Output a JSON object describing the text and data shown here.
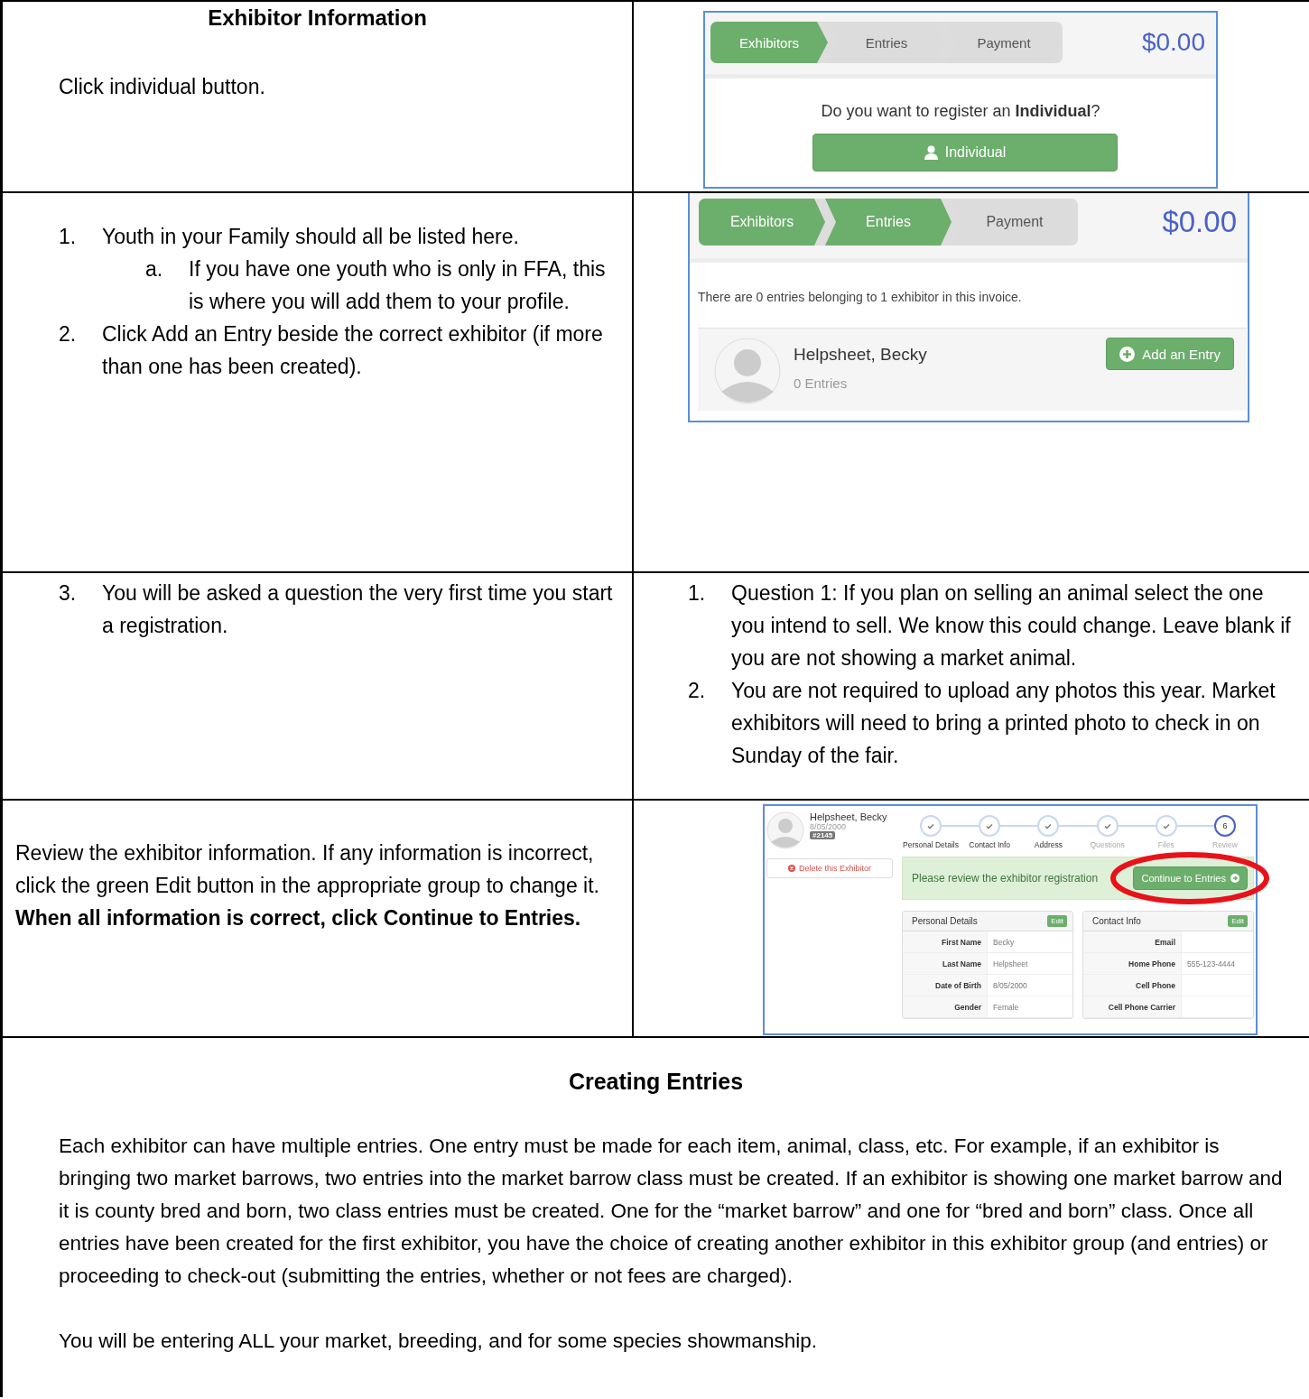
{
  "rows": [
    {
      "left": {
        "kind": "text",
        "title": "Exhibitor Information",
        "paragraphs": [
          "Click individual button."
        ]
      },
      "right": {
        "kind": "register",
        "wizard": {
          "steps": [
            {
              "label": "Exhibitors",
              "done": true
            },
            {
              "label": "Entries",
              "done": false
            },
            {
              "label": "Payment",
              "done": false
            }
          ],
          "total": "$0.00"
        },
        "question": "Do you want to register an **Individual**?",
        "button": "Individual"
      }
    },
    {
      "left": {
        "kind": "list",
        "items": [
          {
            "number": "1.",
            "text": "Youth in your Family should all be listed here.",
            "children": [
              {
                "number": "a.",
                "text": "If you have one youth who is only in FFA, this is where you will add them to your profile."
              }
            ]
          },
          {
            "number": "2.",
            "text": "Click Add an Entry beside the correct exhibitor (if more than one has been created)."
          }
        ]
      },
      "right": {
        "kind": "entries",
        "wizard": {
          "steps": [
            {
              "label": "Exhibitors",
              "done": true
            },
            {
              "label": "Entries",
              "done": true
            },
            {
              "label": "Payment",
              "done": false
            }
          ],
          "total": "$0.00"
        },
        "summary": "There are 0 entries belonging to 1 exhibitor in this invoice.",
        "exhibitor": {
          "name": "Helpsheet, Becky",
          "count": "0 Entries"
        },
        "button": "Add an Entry"
      }
    },
    {
      "left": {
        "kind": "list",
        "items": [
          {
            "number": "3.",
            "text": "You will be asked a question the very first time you start a registration."
          }
        ]
      },
      "right": {
        "kind": "list",
        "items": [
          {
            "number": "1.",
            "text": "Question 1: If you plan on selling an animal select the one you intend to sell. We know this could change. Leave blank if you are not showing a market animal."
          },
          {
            "number": "2.",
            "text": "You are not required to upload any photos this year. Market exhibitors will need to bring a printed photo to check in on Sunday of the fair."
          }
        ]
      }
    },
    {
      "left": {
        "kind": "text",
        "paragraphs": [
          "Review the exhibitor information. If any information is incorrect, click the green Edit button in the appropriate group to change it. **When all information is correct, click Continue to Entries.**"
        ]
      },
      "right": {
        "kind": "review",
        "exhibitor": {
          "name": "Helpsheet, Becky",
          "dob": "8/05/2000",
          "badge": "#2145"
        },
        "delete": "Delete this Exhibitor",
        "steps": [
          {
            "label": "Personal Details",
            "done": true,
            "disabled": false
          },
          {
            "label": "Contact Info",
            "done": true,
            "disabled": false
          },
          {
            "label": "Address",
            "done": true,
            "disabled": false
          },
          {
            "label": "Questions",
            "done": true,
            "disabled": true
          },
          {
            "label": "Files",
            "done": true,
            "disabled": true
          },
          {
            "label": "Review",
            "done": false,
            "number": "6",
            "disabled": true
          }
        ],
        "alert": "Please review the exhibitor registration",
        "continue": {
          "label": "Continue to Entries",
          "highlighted": true
        },
        "panels": [
          {
            "title": "Personal Details",
            "edit": "Edit",
            "fields": [
              {
                "label": "First Name",
                "value": "Becky"
              },
              {
                "label": "Last Name",
                "value": "Helpsheet"
              },
              {
                "label": "Date of Birth",
                "value": "8/05/2000"
              },
              {
                "label": "Gender",
                "value": "Female"
              }
            ]
          },
          {
            "title": "Contact Info",
            "edit": "Edit",
            "fields": [
              {
                "label": "Email"
              },
              {
                "label": "Home Phone",
                "value": "555-123-4444"
              },
              {
                "label": "Cell Phone"
              },
              {
                "label": "Cell Phone Carrier"
              }
            ]
          }
        ]
      }
    }
  ],
  "footer": {
    "title": "Creating Entries",
    "paragraphs": [
      "Each exhibitor can have multiple entries. One entry must be made for each item, animal, class, etc. For example, if an exhibitor is bringing two market barrows, two entries into the market barrow class must be created. If an exhibitor is showing one market barrow and it is county bred and born, two class entries must be created. One for the “market barrow” and one for “bred and born” class. Once all entries have been created for the first exhibitor, you have the choice of creating another exhibitor in this exhibitor group (and entries) or proceeding to check-out (submitting the entries, whether or not fees are charged).",
      "You will be entering ALL your market, breeding, and for some species showmanship."
    ]
  }
}
